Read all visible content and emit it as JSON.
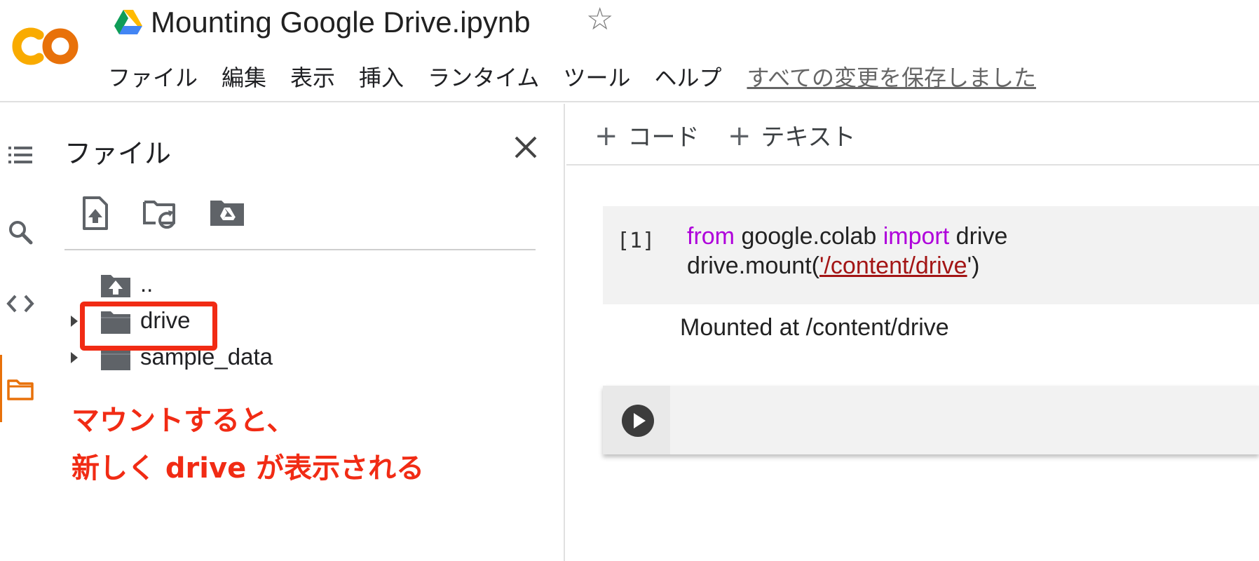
{
  "header": {
    "notebook_title": "Mounting Google Drive.ipynb",
    "star_glyph": "☆",
    "menu": [
      "ファイル",
      "編集",
      "表示",
      "挿入",
      "ランタイム",
      "ツール",
      "ヘルプ"
    ],
    "save_status": "すべての変更を保存しました"
  },
  "rail": {
    "icons": [
      "table-of-contents-icon",
      "search-icon",
      "code-snippets-icon",
      "files-icon"
    ],
    "active": "files-icon",
    "active_color": "#e8710a"
  },
  "files_panel": {
    "title": "ファイル",
    "close_glyph": "✕",
    "toolbar": [
      "upload-icon",
      "refresh-folder-icon",
      "mount-drive-icon"
    ],
    "tree": [
      {
        "label": "..",
        "icon": "folder-up-icon",
        "expandable": false
      },
      {
        "label": "drive",
        "icon": "folder-icon",
        "expandable": true,
        "highlighted": true
      },
      {
        "label": "sample_data",
        "icon": "folder-icon",
        "expandable": true
      }
    ],
    "annotation_line1": "マウントすると、",
    "annotation_line2": "新しく drive が表示される",
    "annotation_color": "#f12b14"
  },
  "notebook": {
    "add_code_label": "コード",
    "add_text_label": "テキスト",
    "plus_glyph": "+",
    "cells": [
      {
        "exec_count": "[1]",
        "line1": {
          "kw1": "from",
          "mod": "google.colab",
          "kw2": "import",
          "name": "drive"
        },
        "line2": {
          "call": "drive.mount(",
          "quote_open": "'",
          "path": "/content/drive",
          "quote_close": "')"
        },
        "output": "Mounted at /content/drive"
      }
    ]
  },
  "colors": {
    "keyword": "#af00db",
    "string": "#a31515",
    "colab_orange": "#f9ab00",
    "colab_orange_dark": "#e8710a"
  }
}
